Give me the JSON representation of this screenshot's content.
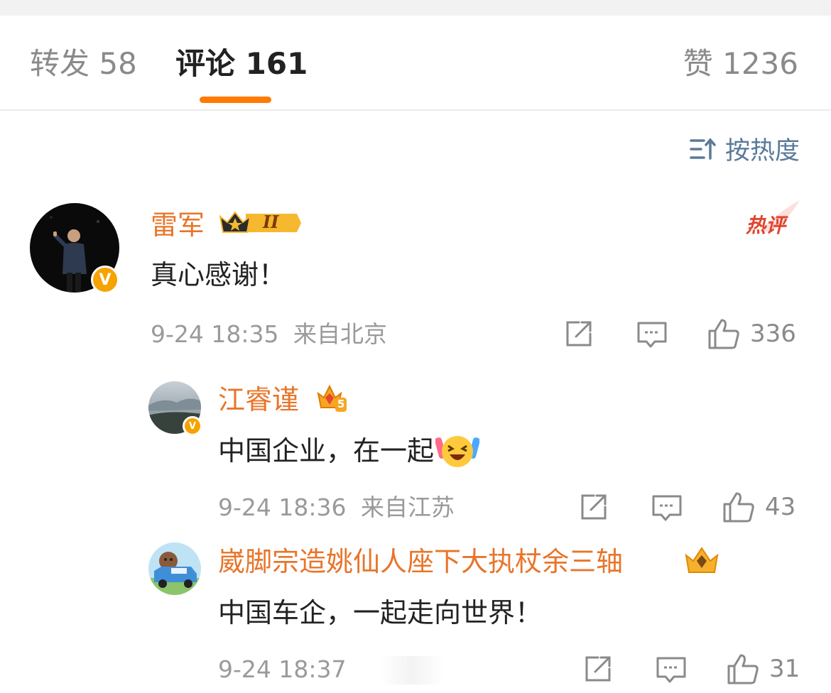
{
  "tabs": {
    "repost": "转发 58",
    "comment": "评论 161",
    "like": "赞 1236"
  },
  "sort": {
    "label": "按热度"
  },
  "colors": {
    "accent": "#ff7a00",
    "username": "#e8752a",
    "link": "#5b7a9a",
    "hot": "#e0452d"
  },
  "comments": [
    {
      "user": "雷军",
      "level_badge": "II",
      "tag": "热评",
      "text": "真心感谢！",
      "time": "9-24 18:35",
      "location": "来自北京",
      "likes": "336",
      "avatar_icon": "person-on-stage"
    },
    {
      "user": "江睿谨",
      "level_badge": "5",
      "text": "中国企业，在一起",
      "emoji_icon": "laughing-cheer-emoji",
      "time": "9-24 18:36",
      "location": "来自江苏",
      "likes": "43",
      "avatar_icon": "sky-landscape"
    },
    {
      "user": "崴脚宗造姚仙人座下大执杖余三轴",
      "text": "中国车企，一起走向世界！",
      "time": "9-24 18:37",
      "likes": "31",
      "avatar_icon": "cartoon-car"
    }
  ]
}
